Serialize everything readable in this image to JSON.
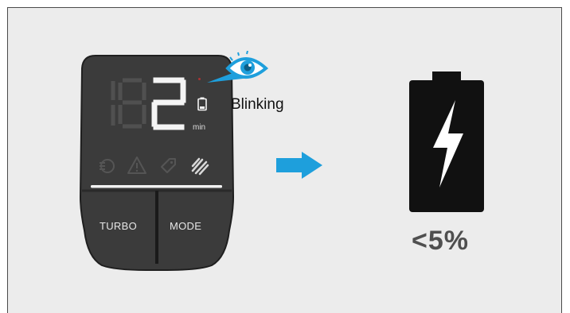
{
  "display": {
    "digits_inactive": "18",
    "digit_active": "2",
    "unit": "min",
    "buttons": {
      "left": "TURBO",
      "right": "MODE"
    },
    "icons": [
      "power-assist-icon",
      "warning-icon",
      "tag-icon",
      "battery-charging-mode-icon"
    ]
  },
  "annotation": {
    "label": "Blinking",
    "icon": "eye-icon"
  },
  "arrow": {
    "icon": "arrow-right-icon",
    "color": "#1e9fdc"
  },
  "battery": {
    "icon": "battery-icon",
    "symbol": "lightning-bolt-icon",
    "level_text": "<5%",
    "level_value": 5
  },
  "colors": {
    "background": "#ececec",
    "device": "#3a3a3a",
    "accent": "#1e9fdc"
  }
}
